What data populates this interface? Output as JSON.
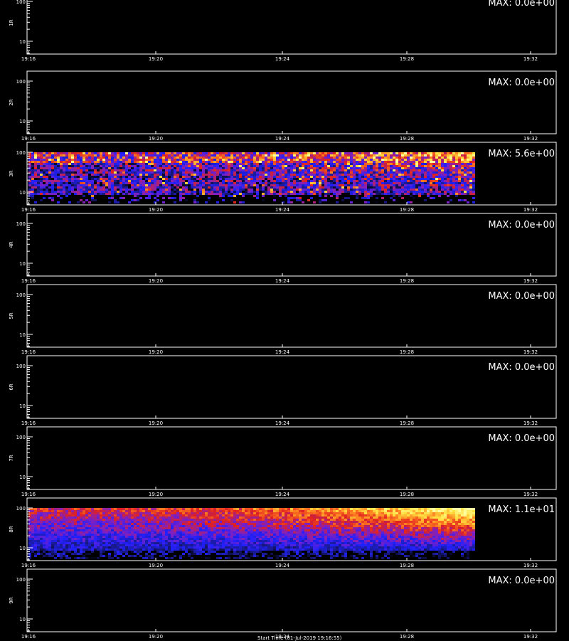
{
  "chart_data": {
    "type": "heatmap",
    "x_tick_labels": [
      "19:16",
      "19:20",
      "19:24",
      "19:28",
      "19:32"
    ],
    "y_tick_labels": [
      "100",
      "10"
    ],
    "yscale": "log",
    "colormap": [
      "#000000",
      "#1a1a8c",
      "#2020ff",
      "#8020c0",
      "#e02020",
      "#ff8020",
      "#ffe040",
      "#ffffa0"
    ],
    "panels": [
      {
        "name": "1R",
        "max_label": "MAX: 0.0e+00",
        "max": 0.0,
        "has_data": false
      },
      {
        "name": "2R",
        "max_label": "MAX: 0.0e+00",
        "max": 0.0,
        "has_data": false
      },
      {
        "name": "3R",
        "max_label": "MAX: 5.6e+00",
        "max": 5.6,
        "has_data": true
      },
      {
        "name": "4R",
        "max_label": "MAX: 0.0e+00",
        "max": 0.0,
        "has_data": false
      },
      {
        "name": "5R",
        "max_label": "MAX: 0.0e+00",
        "max": 0.0,
        "has_data": false
      },
      {
        "name": "6R",
        "max_label": "MAX: 0.0e+00",
        "max": 0.0,
        "has_data": false
      },
      {
        "name": "7R",
        "max_label": "MAX: 0.0e+00",
        "max": 0.0,
        "has_data": false
      },
      {
        "name": "8R",
        "max_label": "MAX: 1.1e+01",
        "max": 11.0,
        "has_data": true
      },
      {
        "name": "9R",
        "max_label": "MAX: 0.0e+00",
        "max": 0.0,
        "has_data": false
      }
    ]
  },
  "footer": "Start Time (01-Jul-2019 19:16:55)"
}
